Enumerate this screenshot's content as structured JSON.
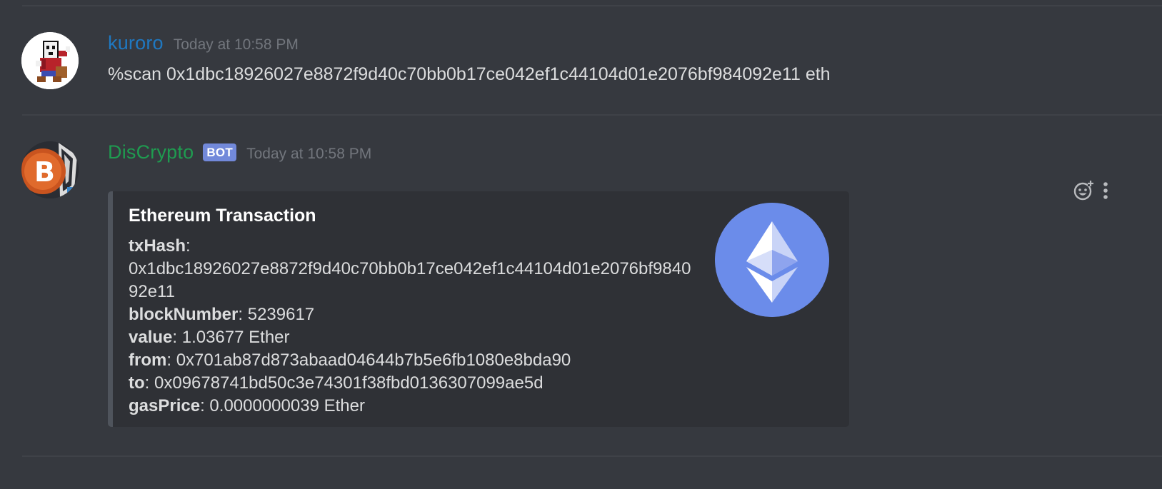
{
  "messages": [
    {
      "username": "kuroro",
      "username_color": "#1f78c1",
      "timestamp": "Today at 10:58 PM",
      "content": "%scan 0x1dbc18926027e8872f9d40c70bb0b17ce042ef1c44104d01e2076bf984092e11 eth"
    },
    {
      "username": "DisCrypto",
      "username_color": "#1f9b50",
      "bot_tag": "BOT",
      "timestamp": "Today at 10:58 PM",
      "embed": {
        "title": "Ethereum Transaction",
        "fields": [
          {
            "key": "txHash",
            "sep": ":",
            "value": "0x1dbc18926027e8872f9d40c70bb0b17ce042ef1c44104d01e2076bf984092e11"
          },
          {
            "key": "blockNumber",
            "sep": ": ",
            "value": "5239617"
          },
          {
            "key": "value",
            "sep": ": ",
            "value": "1.03677 Ether"
          },
          {
            "key": "from",
            "sep": ": ",
            "value": "0x701ab87d873abaad04644b7b5e6fb1080e8bda90"
          },
          {
            "key": "to",
            "sep": ": ",
            "value": "0x09678741bd50c3e74301f38fbd0136307099ae5d"
          },
          {
            "key": "gasPrice",
            "sep": ": ",
            "value": "0.0000000039 Ether"
          }
        ],
        "thumbnail_icon": "ethereum-logo-icon",
        "thumbnail_color": "#6b8cea"
      }
    }
  ],
  "message_actions": [
    {
      "icon": "add-reaction-icon"
    },
    {
      "icon": "more-options-icon"
    }
  ],
  "colors": {
    "background": "#36393f",
    "embed_background": "#2f3136",
    "embed_border": "#4f545c",
    "bot_tag": "#7289da",
    "text": "#dcddde",
    "timestamp": "#72767d"
  }
}
